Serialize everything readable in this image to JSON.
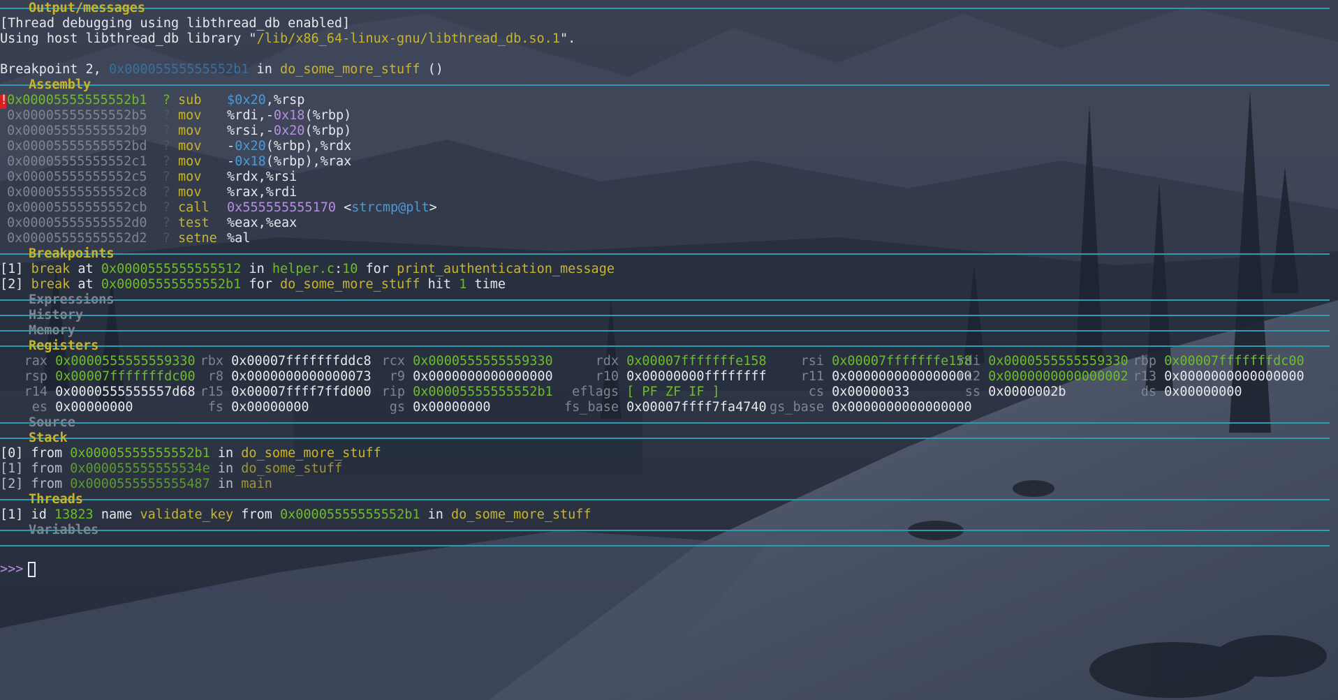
{
  "sections": {
    "output": "Output/messages",
    "assembly": "Assembly",
    "breakpoints": "Breakpoints",
    "expressions": "Expressions",
    "history": "History",
    "memory": "Memory",
    "registers": "Registers",
    "source": "Source",
    "stack": "Stack",
    "threads": "Threads",
    "variables": "Variables"
  },
  "output": {
    "line1": "[Thread debugging using libthread_db enabled]",
    "line2_prefix": "Using host libthread_db library \"",
    "line2_path": "/lib/x86_64-linux-gnu/libthread_db.so.1",
    "line2_suffix": "\".",
    "bp_prefix": "Breakpoint 2, ",
    "bp_addr": "0x00005555555552b1",
    "bp_in": " in ",
    "bp_func": "do_some_more_stuff",
    "bp_parens": " ()"
  },
  "assembly": [
    {
      "marker": "!",
      "addr": "0x00005555555552b1",
      "q": "?",
      "op": "sub",
      "args": [
        {
          "t": "$0x20",
          "c": "blu"
        },
        {
          "t": ",%rsp",
          "c": "w"
        }
      ]
    },
    {
      "marker": "",
      "addr": "0x00005555555552b5",
      "q": "?",
      "op": "mov",
      "args": [
        {
          "t": "%rdi,-",
          "c": "w"
        },
        {
          "t": "0x18",
          "c": "mag"
        },
        {
          "t": "(%rbp)",
          "c": "w"
        }
      ]
    },
    {
      "marker": "",
      "addr": "0x00005555555552b9",
      "q": "?",
      "op": "mov",
      "args": [
        {
          "t": "%rsi,-",
          "c": "w"
        },
        {
          "t": "0x20",
          "c": "mag"
        },
        {
          "t": "(%rbp)",
          "c": "w"
        }
      ]
    },
    {
      "marker": "",
      "addr": "0x00005555555552bd",
      "q": "?",
      "op": "mov",
      "args": [
        {
          "t": "-",
          "c": "w"
        },
        {
          "t": "0x20",
          "c": "blu"
        },
        {
          "t": "(%rbp),%rdx",
          "c": "w"
        }
      ]
    },
    {
      "marker": "",
      "addr": "0x00005555555552c1",
      "q": "?",
      "op": "mov",
      "args": [
        {
          "t": "-",
          "c": "w"
        },
        {
          "t": "0x18",
          "c": "blu"
        },
        {
          "t": "(%rbp),%rax",
          "c": "w"
        }
      ]
    },
    {
      "marker": "",
      "addr": "0x00005555555552c5",
      "q": "?",
      "op": "mov",
      "args": [
        {
          "t": "%rdx,%rsi",
          "c": "w"
        }
      ]
    },
    {
      "marker": "",
      "addr": "0x00005555555552c8",
      "q": "?",
      "op": "mov",
      "args": [
        {
          "t": "%rax,%rdi",
          "c": "w"
        }
      ]
    },
    {
      "marker": "",
      "addr": "0x00005555555552cb",
      "q": "?",
      "op": "call",
      "args": [
        {
          "t": "0x555555555170",
          "c": "mag"
        },
        {
          "t": " <",
          "c": "w"
        },
        {
          "t": "strcmp@plt",
          "c": "blu"
        },
        {
          "t": ">",
          "c": "w"
        }
      ]
    },
    {
      "marker": "",
      "addr": "0x00005555555552d0",
      "q": "?",
      "op": "test",
      "args": [
        {
          "t": "%eax,%eax",
          "c": "w"
        }
      ]
    },
    {
      "marker": "",
      "addr": "0x00005555555552d2",
      "q": "?",
      "op": "setne",
      "args": [
        {
          "t": "%al",
          "c": "w"
        }
      ]
    }
  ],
  "breakpoints": [
    {
      "idx": "[1]",
      "kw": "break",
      "at": " at ",
      "addr": "0x0000555555555512",
      "in": " in ",
      "file": "helper.c",
      "colon": ":",
      "line": "10",
      "for": " for ",
      "func": "print_authentication_message",
      "hit": "",
      "count": "",
      "time": ""
    },
    {
      "idx": "[2]",
      "kw": "break",
      "at": " at ",
      "addr": "0x00005555555552b1",
      "in": "",
      "file": "",
      "colon": "",
      "line": "",
      "for": " for ",
      "func": "do_some_more_stuff",
      "hit": " hit ",
      "count": "1",
      "time": " time"
    }
  ],
  "registers": [
    [
      {
        "name": "rax",
        "value": "0x0000555555559330",
        "changed": true
      },
      {
        "name": "rbx",
        "value": "0x00007fffffffddc8",
        "changed": false
      },
      {
        "name": "rcx",
        "value": "0x0000555555559330",
        "changed": true
      },
      {
        "name": "rdx",
        "value": "0x00007fffffffe158",
        "changed": true
      },
      {
        "name": "rsi",
        "value": "0x00007fffffffe158",
        "changed": true
      },
      {
        "name": "rdi",
        "value": "0x0000555555559330",
        "changed": true
      },
      {
        "name": "rbp",
        "value": "0x00007fffffffdc00",
        "changed": true
      }
    ],
    [
      {
        "name": "rsp",
        "value": "0x00007fffffffdc00",
        "changed": true
      },
      {
        "name": "r8",
        "value": "0x0000000000000073",
        "changed": false
      },
      {
        "name": "r9",
        "value": "0x0000000000000000",
        "changed": false
      },
      {
        "name": "r10",
        "value": "0x00000000ffffffff",
        "changed": false
      },
      {
        "name": "r11",
        "value": "0x0000000000000000",
        "changed": false
      },
      {
        "name": "r12",
        "value": "0x0000000000000002",
        "changed": true
      },
      {
        "name": "r13",
        "value": "0x0000000000000000",
        "changed": false
      }
    ],
    [
      {
        "name": "r14",
        "value": "0x0000555555557d68",
        "changed": false
      },
      {
        "name": "r15",
        "value": "0x00007ffff7ffd000",
        "changed": false
      },
      {
        "name": "rip",
        "value": "0x00005555555552b1",
        "changed": true
      },
      {
        "name": "eflags",
        "value": "[ PF ZF IF ]",
        "changed": true
      },
      {
        "name": "cs",
        "value": "0x00000033",
        "changed": false
      },
      {
        "name": "ss",
        "value": "0x0000002b",
        "changed": false
      },
      {
        "name": "ds",
        "value": "0x00000000",
        "changed": false
      }
    ],
    [
      {
        "name": "es",
        "value": "0x00000000",
        "changed": false
      },
      {
        "name": "fs",
        "value": "0x00000000",
        "changed": false
      },
      {
        "name": "gs",
        "value": "0x00000000",
        "changed": false
      },
      {
        "name": "fs_base",
        "value": "0x00007ffff7fa4740",
        "changed": false
      },
      {
        "name": "gs_base",
        "value": "0x0000000000000000",
        "changed": false
      }
    ]
  ],
  "stack": [
    {
      "idx": "[0]",
      "from": " from ",
      "addr": "0x00005555555552b1",
      "in": " in ",
      "func": "do_some_more_stuff",
      "current": true
    },
    {
      "idx": "[1]",
      "from": " from ",
      "addr": "0x000055555555534e",
      "in": " in ",
      "func": "do_some_stuff",
      "current": false
    },
    {
      "idx": "[2]",
      "from": " from ",
      "addr": "0x0000555555555487",
      "in": " in ",
      "func": "main",
      "current": false
    }
  ],
  "threads": [
    {
      "idx": "[1]",
      "id_kw": " id ",
      "id": "13823",
      "name_kw": " name ",
      "name": "validate_key",
      "from_kw": " from ",
      "addr": "0x00005555555552b1",
      "in_kw": " in ",
      "func": "do_some_more_stuff"
    }
  ],
  "prompt": ">>> "
}
